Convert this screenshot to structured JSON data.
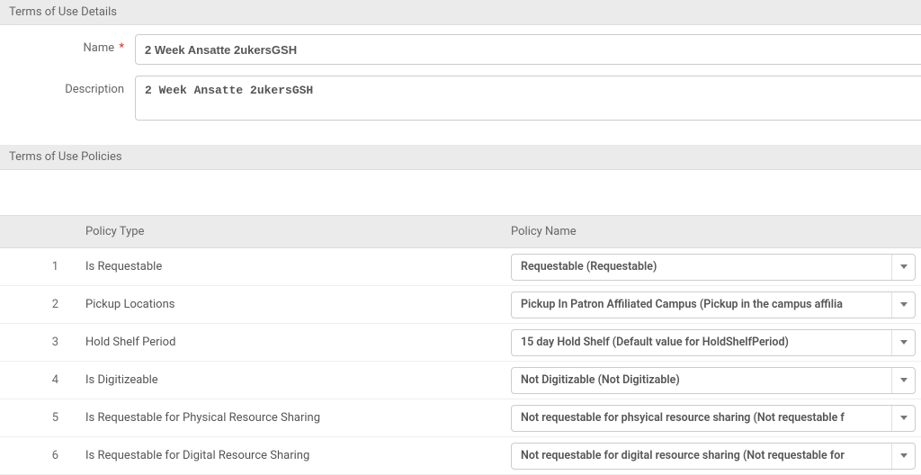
{
  "sections": {
    "details_header": "Terms of Use Details",
    "policies_header": "Terms of Use Policies"
  },
  "form": {
    "name_label": "Name",
    "name_value": "2 Week Ansatte 2ukersGSH",
    "description_label": "Description",
    "description_value": "2 Week Ansatte 2ukersGSH"
  },
  "table": {
    "col_type": "Policy Type",
    "col_name": "Policy Name",
    "rows": [
      {
        "idx": "1",
        "type": "Is Requestable",
        "name": "Requestable (Requestable)"
      },
      {
        "idx": "2",
        "type": "Pickup Locations",
        "name": "Pickup In Patron Affiliated Campus (Pickup in the campus affilia"
      },
      {
        "idx": "3",
        "type": "Hold Shelf Period",
        "name": "15 day Hold Shelf (Default value for HoldShelfPeriod)"
      },
      {
        "idx": "4",
        "type": "Is Digitizeable",
        "name": "Not Digitizable (Not Digitizable)"
      },
      {
        "idx": "5",
        "type": "Is Requestable for Physical Resource Sharing",
        "name": "Not requestable for phsyical resource sharing (Not requestable f"
      },
      {
        "idx": "6",
        "type": "Is Requestable for Digital Resource Sharing",
        "name": "Not requestable for digital resource sharing (Not requestable for"
      }
    ]
  }
}
